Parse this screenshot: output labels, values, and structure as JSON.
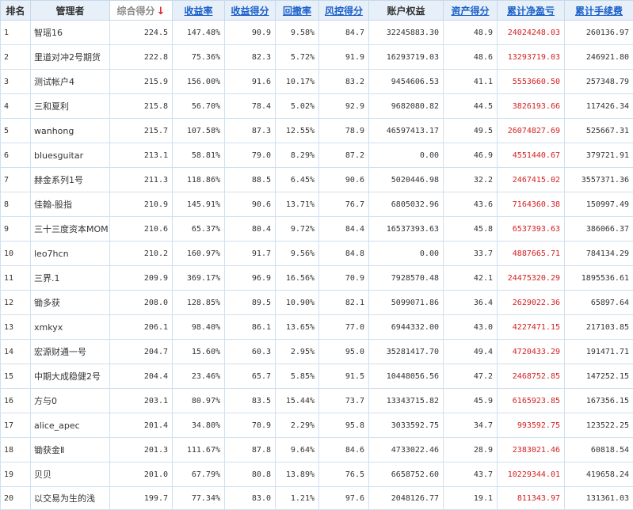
{
  "columns": [
    {
      "key": "rank",
      "label": "排名",
      "type": "plain"
    },
    {
      "key": "manager",
      "label": "管理者",
      "type": "plain"
    },
    {
      "key": "score",
      "label": "综合得分",
      "type": "sorted",
      "sort_indicator": "↓"
    },
    {
      "key": "return_rate",
      "label": "收益率",
      "type": "link"
    },
    {
      "key": "return_score",
      "label": "收益得分",
      "type": "link"
    },
    {
      "key": "drawdown",
      "label": "回撤率",
      "type": "link"
    },
    {
      "key": "risk_score",
      "label": "风控得分",
      "type": "link"
    },
    {
      "key": "equity",
      "label": "账户权益",
      "type": "plain"
    },
    {
      "key": "asset_score",
      "label": "资产得分",
      "type": "link"
    },
    {
      "key": "net_profit",
      "label": "累计净盈亏",
      "type": "link"
    },
    {
      "key": "fees",
      "label": "累计手续费",
      "type": "link"
    }
  ],
  "colors": {
    "header_bg": "#e7f0f9",
    "link": "#1a5fc9",
    "profit": "#d42020",
    "border": "#cfe0ef",
    "sort_arrow": "#e02020"
  },
  "rows": [
    {
      "rank": "1",
      "manager": "智瑶16",
      "score": "224.5",
      "return_rate": "147.48%",
      "return_score": "90.9",
      "drawdown": "9.58%",
      "risk_score": "84.7",
      "equity": "32245883.30",
      "asset_score": "48.9",
      "net_profit": "24024248.03",
      "fees": "260136.97"
    },
    {
      "rank": "2",
      "manager": "里道对冲2号期货",
      "score": "222.8",
      "return_rate": "75.36%",
      "return_score": "82.3",
      "drawdown": "5.72%",
      "risk_score": "91.9",
      "equity": "16293719.03",
      "asset_score": "48.6",
      "net_profit": "13293719.03",
      "fees": "246921.80"
    },
    {
      "rank": "3",
      "manager": "测试帐户4",
      "score": "215.9",
      "return_rate": "156.00%",
      "return_score": "91.6",
      "drawdown": "10.17%",
      "risk_score": "83.2",
      "equity": "9454606.53",
      "asset_score": "41.1",
      "net_profit": "5553660.50",
      "fees": "257348.79"
    },
    {
      "rank": "4",
      "manager": "三和夏利",
      "score": "215.8",
      "return_rate": "56.70%",
      "return_score": "78.4",
      "drawdown": "5.02%",
      "risk_score": "92.9",
      "equity": "9682080.82",
      "asset_score": "44.5",
      "net_profit": "3826193.66",
      "fees": "117426.34"
    },
    {
      "rank": "5",
      "manager": "wanhong",
      "score": "215.7",
      "return_rate": "107.58%",
      "return_score": "87.3",
      "drawdown": "12.55%",
      "risk_score": "78.9",
      "equity": "46597413.17",
      "asset_score": "49.5",
      "net_profit": "26074827.69",
      "fees": "525667.31"
    },
    {
      "rank": "6",
      "manager": "bluesguitar",
      "score": "213.1",
      "return_rate": "58.81%",
      "return_score": "79.0",
      "drawdown": "8.29%",
      "risk_score": "87.2",
      "equity": "0.00",
      "asset_score": "46.9",
      "net_profit": "4551440.67",
      "fees": "379721.91"
    },
    {
      "rank": "7",
      "manager": "赫金系列1号",
      "score": "211.3",
      "return_rate": "118.86%",
      "return_score": "88.5",
      "drawdown": "6.45%",
      "risk_score": "90.6",
      "equity": "5020446.98",
      "asset_score": "32.2",
      "net_profit": "2467415.02",
      "fees": "3557371.36"
    },
    {
      "rank": "8",
      "manager": "佳翰-股指",
      "score": "210.9",
      "return_rate": "145.91%",
      "return_score": "90.6",
      "drawdown": "13.71%",
      "risk_score": "76.7",
      "equity": "6805032.96",
      "asset_score": "43.6",
      "net_profit": "7164360.38",
      "fees": "150997.49"
    },
    {
      "rank": "9",
      "manager": "三十三度资本MOM",
      "score": "210.6",
      "return_rate": "65.37%",
      "return_score": "80.4",
      "drawdown": "9.72%",
      "risk_score": "84.4",
      "equity": "16537393.63",
      "asset_score": "45.8",
      "net_profit": "6537393.63",
      "fees": "386066.37"
    },
    {
      "rank": "10",
      "manager": "leo7hcn",
      "score": "210.2",
      "return_rate": "160.97%",
      "return_score": "91.7",
      "drawdown": "9.56%",
      "risk_score": "84.8",
      "equity": "0.00",
      "asset_score": "33.7",
      "net_profit": "4887665.71",
      "fees": "784134.29"
    },
    {
      "rank": "11",
      "manager": "三界.1",
      "score": "209.9",
      "return_rate": "369.17%",
      "return_score": "96.9",
      "drawdown": "16.56%",
      "risk_score": "70.9",
      "equity": "7928570.48",
      "asset_score": "42.1",
      "net_profit": "24475320.29",
      "fees": "1895536.61"
    },
    {
      "rank": "12",
      "manager": "锄多获",
      "score": "208.0",
      "return_rate": "128.85%",
      "return_score": "89.5",
      "drawdown": "10.90%",
      "risk_score": "82.1",
      "equity": "5099071.86",
      "asset_score": "36.4",
      "net_profit": "2629022.36",
      "fees": "65897.64"
    },
    {
      "rank": "13",
      "manager": "xmkyx",
      "score": "206.1",
      "return_rate": "98.40%",
      "return_score": "86.1",
      "drawdown": "13.65%",
      "risk_score": "77.0",
      "equity": "6944332.00",
      "asset_score": "43.0",
      "net_profit": "4227471.15",
      "fees": "217103.85"
    },
    {
      "rank": "14",
      "manager": "宏源财通一号",
      "score": "204.7",
      "return_rate": "15.60%",
      "return_score": "60.3",
      "drawdown": "2.95%",
      "risk_score": "95.0",
      "equity": "35281417.70",
      "asset_score": "49.4",
      "net_profit": "4720433.29",
      "fees": "191471.71"
    },
    {
      "rank": "15",
      "manager": "中期大成稳健2号",
      "score": "204.4",
      "return_rate": "23.46%",
      "return_score": "65.7",
      "drawdown": "5.85%",
      "risk_score": "91.5",
      "equity": "10448056.56",
      "asset_score": "47.2",
      "net_profit": "2468752.85",
      "fees": "147252.15"
    },
    {
      "rank": "16",
      "manager": "方与0",
      "score": "203.1",
      "return_rate": "80.97%",
      "return_score": "83.5",
      "drawdown": "15.44%",
      "risk_score": "73.7",
      "equity": "13343715.82",
      "asset_score": "45.9",
      "net_profit": "6165923.85",
      "fees": "167356.15"
    },
    {
      "rank": "17",
      "manager": "alice_apec",
      "score": "201.4",
      "return_rate": "34.80%",
      "return_score": "70.9",
      "drawdown": "2.29%",
      "risk_score": "95.8",
      "equity": "3033592.75",
      "asset_score": "34.7",
      "net_profit": "993592.75",
      "fees": "123522.25"
    },
    {
      "rank": "18",
      "manager": "锄获金Ⅱ",
      "score": "201.3",
      "return_rate": "111.67%",
      "return_score": "87.8",
      "drawdown": "9.64%",
      "risk_score": "84.6",
      "equity": "4733022.46",
      "asset_score": "28.9",
      "net_profit": "2383021.46",
      "fees": "60818.54"
    },
    {
      "rank": "19",
      "manager": "贝贝",
      "score": "201.0",
      "return_rate": "67.79%",
      "return_score": "80.8",
      "drawdown": "13.89%",
      "risk_score": "76.5",
      "equity": "6658752.60",
      "asset_score": "43.7",
      "net_profit": "10229344.01",
      "fees": "419658.24"
    },
    {
      "rank": "20",
      "manager": "以交易为生的浅",
      "score": "199.7",
      "return_rate": "77.34%",
      "return_score": "83.0",
      "drawdown": "1.21%",
      "risk_score": "97.6",
      "equity": "2048126.77",
      "asset_score": "19.1",
      "net_profit": "811343.97",
      "fees": "131361.03"
    }
  ]
}
